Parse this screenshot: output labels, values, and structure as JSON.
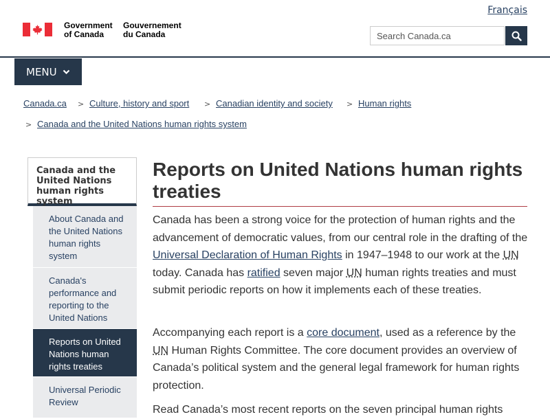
{
  "header": {
    "language_link": "Français",
    "signature_en": [
      "Government",
      "of Canada"
    ],
    "signature_fr": [
      "Gouvernement",
      "du Canada"
    ],
    "search_placeholder": "Search Canada.ca",
    "menu_label": "MENU"
  },
  "breadcrumbs": [
    "Canada.ca",
    "Culture, history and sport",
    "Canadian identity and society",
    "Human rights",
    "Canada and the United Nations human rights system"
  ],
  "sidebar": {
    "heading": "Canada and the United Nations human rights system",
    "items": [
      {
        "label": "About Canada and the United Nations human rights system",
        "active": false
      },
      {
        "label": "Canada's performance and reporting to the United Nations",
        "active": false
      },
      {
        "label": "Reports on United Nations human rights treaties",
        "active": true
      },
      {
        "label": "Universal Periodic Review",
        "active": false
      }
    ]
  },
  "main": {
    "title": "Reports on United Nations human rights treaties",
    "para1": {
      "t1": "Canada has been a strong voice for the protection of human rights and the advancement of democratic values, from our central role in the drafting of the ",
      "link1": "Universal Declaration of Human Rights",
      "t2": " in 1947–1948 to our work at the ",
      "abbr1": "UN",
      "t3": " today. Canada has ",
      "link2": "ratified",
      "t4": " seven major ",
      "abbr2": "UN",
      "t5": " human rights treaties and must submit periodic reports on how it implements each of these treaties."
    },
    "para2": {
      "t1": "Accompanying each report is a ",
      "link1": "core document",
      "t2": ", used as a reference by the ",
      "abbr1": "UN",
      "t3": " Human Rights Committee. The core document provides an overview of Canada’s political system and the general legal framework for human rights protection."
    },
    "para3": "Read Canada’s most recent reports on the seven principal human rights"
  }
}
